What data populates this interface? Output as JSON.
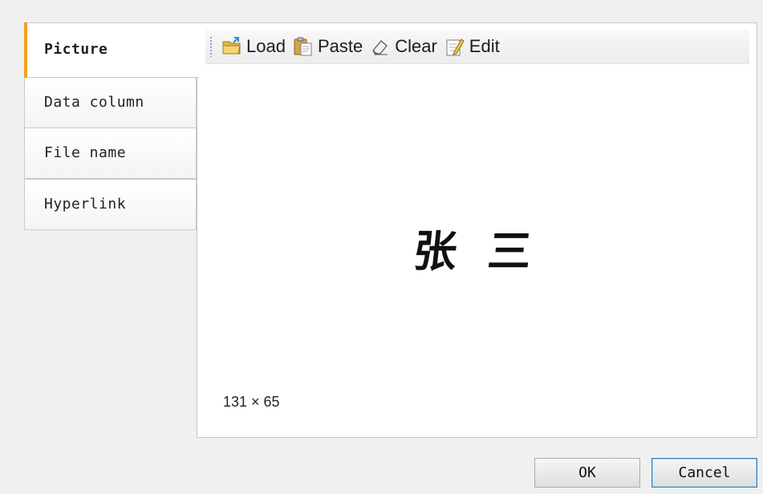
{
  "tabs": {
    "picture": "Picture",
    "data_column": "Data column",
    "file_name": "File name",
    "hyperlink": "Hyperlink"
  },
  "toolbar": {
    "load": "Load",
    "paste": "Paste",
    "clear": "Clear",
    "edit": "Edit"
  },
  "preview": {
    "signature_text": "张 三",
    "size_text": "131 × 65"
  },
  "buttons": {
    "ok": "OK",
    "cancel": "Cancel"
  },
  "colors": {
    "active_tab_accent": "#f0a020",
    "cancel_border": "#3c7fb1"
  }
}
